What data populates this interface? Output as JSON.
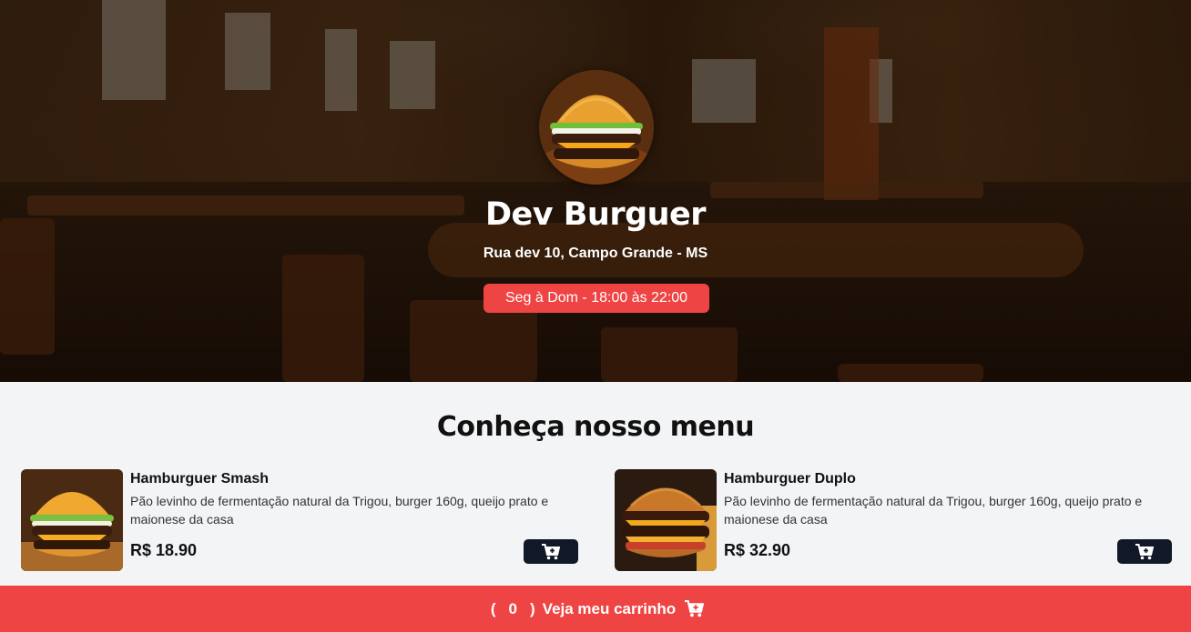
{
  "header": {
    "name": "Dev Burguer",
    "address": "Rua dev 10, Campo Grande - MS",
    "hours": "Seg à Dom - 18:00 às 22:00"
  },
  "menu": {
    "title": "Conheça nosso menu",
    "items": [
      {
        "name": "Hamburguer Smash",
        "description": "Pão levinho de fermentação natural da Trigou, burger 160g, queijo prato e maionese da casa",
        "price": "R$ 18.90"
      },
      {
        "name": "Hamburguer Duplo",
        "description": "Pão levinho de fermentação natural da Trigou, burger 160g, queijo prato e maionese da casa",
        "price": "R$ 32.90"
      }
    ]
  },
  "cart": {
    "open_paren": "(",
    "count": "0",
    "close_paren": ")",
    "label": "Veja meu carrinho"
  },
  "colors": {
    "accent": "#ef4444",
    "button_dark": "#111827",
    "background": "#f3f4f6"
  },
  "icons": [
    "cart-plus-icon",
    "cart-icon",
    "burger-logo"
  ]
}
